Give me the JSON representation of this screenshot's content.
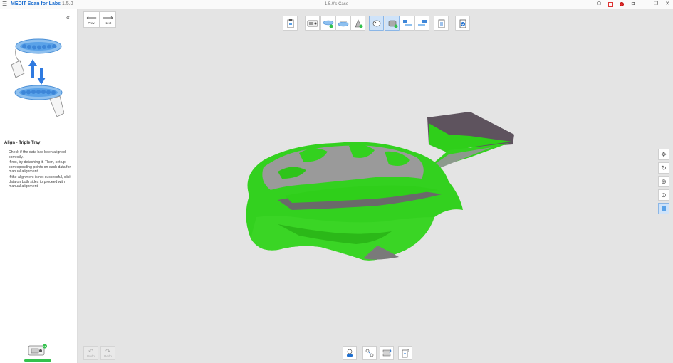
{
  "titlebar": {
    "menu_icon": "hamburger-icon",
    "brand_name": "MEDIT",
    "app_name": "Scan for Labs",
    "version": "1.5.0",
    "case_name": "1.5.0's Case"
  },
  "left_panel": {
    "collapse_symbol": "«",
    "section_title": "Align - Triple Tray",
    "instructions": [
      "Check if the data has been aligned correctly.",
      "If not, try detaching it. Then, set up corresponding points on each data for manual alignment.",
      "If the alignment is not successful, click data on both sides to proceed with manual alignment."
    ]
  },
  "nav": {
    "prev_label": "Prev.",
    "next_label": "Next"
  },
  "bottom_left": {
    "undo_label": "Undo",
    "redo_label": "Redo"
  },
  "colors": {
    "accent": "#1e6fd0",
    "active_tool": "#cfe3f9",
    "scan_green": "#33d11f",
    "scan_gray": "#9a9a9a",
    "progress_green": "#33c24d"
  }
}
